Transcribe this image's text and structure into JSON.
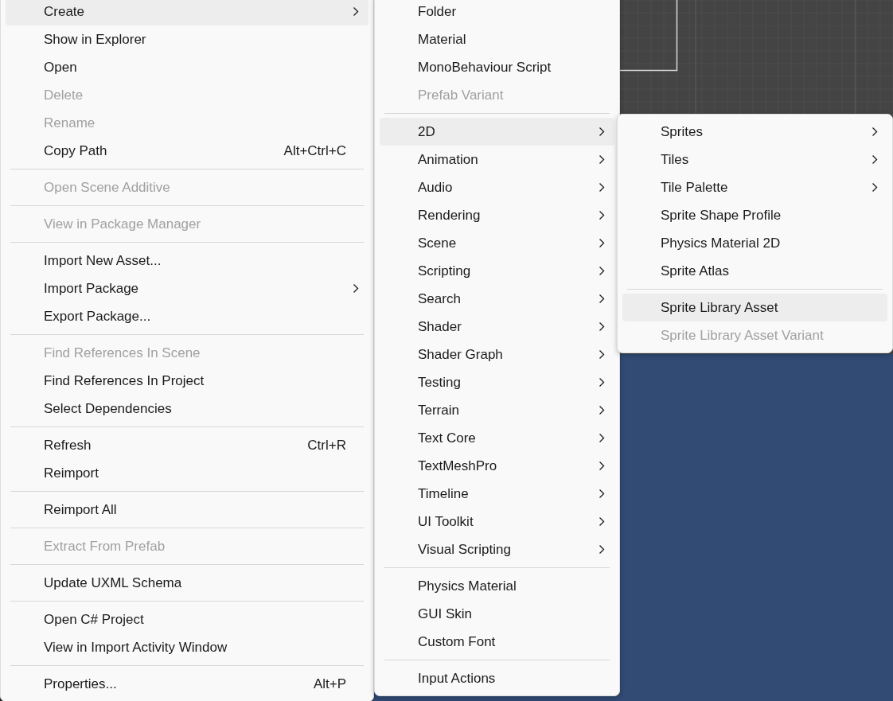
{
  "menus": [
    {
      "items": [
        {
          "kind": "item",
          "label": "Create",
          "disabled": false,
          "selected": true,
          "submenu": true
        },
        {
          "kind": "item",
          "label": "Show in Explorer",
          "disabled": false,
          "selected": false,
          "submenu": false
        },
        {
          "kind": "item",
          "label": "Open",
          "disabled": false,
          "selected": false,
          "submenu": false
        },
        {
          "kind": "item",
          "label": "Delete",
          "disabled": true,
          "selected": false,
          "submenu": false
        },
        {
          "kind": "item",
          "label": "Rename",
          "disabled": true,
          "selected": false,
          "submenu": false
        },
        {
          "kind": "item",
          "label": "Copy Path",
          "disabled": false,
          "selected": false,
          "submenu": false,
          "shortcut": "Alt+Ctrl+C"
        },
        {
          "kind": "separator"
        },
        {
          "kind": "item",
          "label": "Open Scene Additive",
          "disabled": true,
          "selected": false,
          "submenu": false
        },
        {
          "kind": "separator"
        },
        {
          "kind": "item",
          "label": "View in Package Manager",
          "disabled": true,
          "selected": false,
          "submenu": false
        },
        {
          "kind": "separator"
        },
        {
          "kind": "item",
          "label": "Import New Asset...",
          "disabled": false,
          "selected": false,
          "submenu": false
        },
        {
          "kind": "item",
          "label": "Import Package",
          "disabled": false,
          "selected": false,
          "submenu": true
        },
        {
          "kind": "item",
          "label": "Export Package...",
          "disabled": false,
          "selected": false,
          "submenu": false
        },
        {
          "kind": "separator"
        },
        {
          "kind": "item",
          "label": "Find References In Scene",
          "disabled": true,
          "selected": false,
          "submenu": false
        },
        {
          "kind": "item",
          "label": "Find References In Project",
          "disabled": false,
          "selected": false,
          "submenu": false
        },
        {
          "kind": "item",
          "label": "Select Dependencies",
          "disabled": false,
          "selected": false,
          "submenu": false
        },
        {
          "kind": "separator"
        },
        {
          "kind": "item",
          "label": "Refresh",
          "disabled": false,
          "selected": false,
          "submenu": false,
          "shortcut": "Ctrl+R"
        },
        {
          "kind": "item",
          "label": "Reimport",
          "disabled": false,
          "selected": false,
          "submenu": false
        },
        {
          "kind": "separator"
        },
        {
          "kind": "item",
          "label": "Reimport All",
          "disabled": false,
          "selected": false,
          "submenu": false
        },
        {
          "kind": "separator"
        },
        {
          "kind": "item",
          "label": "Extract From Prefab",
          "disabled": true,
          "selected": false,
          "submenu": false
        },
        {
          "kind": "separator"
        },
        {
          "kind": "item",
          "label": "Update UXML Schema",
          "disabled": false,
          "selected": false,
          "submenu": false
        },
        {
          "kind": "separator"
        },
        {
          "kind": "item",
          "label": "Open C# Project",
          "disabled": false,
          "selected": false,
          "submenu": false
        },
        {
          "kind": "item",
          "label": "View in Import Activity Window",
          "disabled": false,
          "selected": false,
          "submenu": false
        },
        {
          "kind": "separator"
        },
        {
          "kind": "item",
          "label": "Properties...",
          "disabled": false,
          "selected": false,
          "submenu": false,
          "shortcut": "Alt+P"
        }
      ]
    },
    {
      "items": [
        {
          "kind": "item",
          "label": "Folder",
          "disabled": false,
          "selected": false,
          "submenu": false
        },
        {
          "kind": "item",
          "label": "Material",
          "disabled": false,
          "selected": false,
          "submenu": false
        },
        {
          "kind": "item",
          "label": "MonoBehaviour Script",
          "disabled": false,
          "selected": false,
          "submenu": false
        },
        {
          "kind": "item",
          "label": "Prefab Variant",
          "disabled": true,
          "selected": false,
          "submenu": false
        },
        {
          "kind": "separator"
        },
        {
          "kind": "item",
          "label": "2D",
          "disabled": false,
          "selected": true,
          "submenu": true
        },
        {
          "kind": "item",
          "label": "Animation",
          "disabled": false,
          "selected": false,
          "submenu": true
        },
        {
          "kind": "item",
          "label": "Audio",
          "disabled": false,
          "selected": false,
          "submenu": true
        },
        {
          "kind": "item",
          "label": "Rendering",
          "disabled": false,
          "selected": false,
          "submenu": true
        },
        {
          "kind": "item",
          "label": "Scene",
          "disabled": false,
          "selected": false,
          "submenu": true
        },
        {
          "kind": "item",
          "label": "Scripting",
          "disabled": false,
          "selected": false,
          "submenu": true
        },
        {
          "kind": "item",
          "label": "Search",
          "disabled": false,
          "selected": false,
          "submenu": true
        },
        {
          "kind": "item",
          "label": "Shader",
          "disabled": false,
          "selected": false,
          "submenu": true
        },
        {
          "kind": "item",
          "label": "Shader Graph",
          "disabled": false,
          "selected": false,
          "submenu": true
        },
        {
          "kind": "item",
          "label": "Testing",
          "disabled": false,
          "selected": false,
          "submenu": true
        },
        {
          "kind": "item",
          "label": "Terrain",
          "disabled": false,
          "selected": false,
          "submenu": true
        },
        {
          "kind": "item",
          "label": "Text Core",
          "disabled": false,
          "selected": false,
          "submenu": true
        },
        {
          "kind": "item",
          "label": "TextMeshPro",
          "disabled": false,
          "selected": false,
          "submenu": true
        },
        {
          "kind": "item",
          "label": "Timeline",
          "disabled": false,
          "selected": false,
          "submenu": true
        },
        {
          "kind": "item",
          "label": "UI Toolkit",
          "disabled": false,
          "selected": false,
          "submenu": true
        },
        {
          "kind": "item",
          "label": "Visual Scripting",
          "disabled": false,
          "selected": false,
          "submenu": true
        },
        {
          "kind": "separator"
        },
        {
          "kind": "item",
          "label": "Physics Material",
          "disabled": false,
          "selected": false,
          "submenu": false
        },
        {
          "kind": "item",
          "label": "GUI Skin",
          "disabled": false,
          "selected": false,
          "submenu": false
        },
        {
          "kind": "item",
          "label": "Custom Font",
          "disabled": false,
          "selected": false,
          "submenu": false
        },
        {
          "kind": "separator"
        },
        {
          "kind": "item",
          "label": "Input Actions",
          "disabled": false,
          "selected": false,
          "submenu": false
        }
      ]
    },
    {
      "items": [
        {
          "kind": "item",
          "label": "Sprites",
          "disabled": false,
          "selected": false,
          "submenu": true
        },
        {
          "kind": "item",
          "label": "Tiles",
          "disabled": false,
          "selected": false,
          "submenu": true
        },
        {
          "kind": "item",
          "label": "Tile Palette",
          "disabled": false,
          "selected": false,
          "submenu": true
        },
        {
          "kind": "item",
          "label": "Sprite Shape Profile",
          "disabled": false,
          "selected": false,
          "submenu": false
        },
        {
          "kind": "item",
          "label": "Physics Material 2D",
          "disabled": false,
          "selected": false,
          "submenu": false
        },
        {
          "kind": "item",
          "label": "Sprite Atlas",
          "disabled": false,
          "selected": false,
          "submenu": false
        },
        {
          "kind": "separator"
        },
        {
          "kind": "item",
          "label": "Sprite Library Asset",
          "disabled": false,
          "selected": true,
          "submenu": false
        },
        {
          "kind": "item",
          "label": "Sprite Library Asset Variant",
          "disabled": true,
          "selected": false,
          "submenu": false
        }
      ]
    }
  ]
}
